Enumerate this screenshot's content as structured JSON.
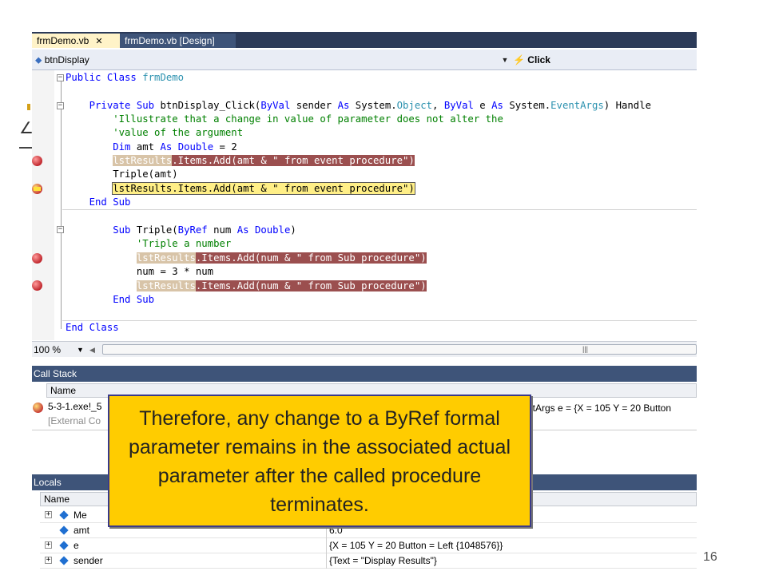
{
  "tabs": [
    {
      "label": "frmDemo.vb",
      "close": "✕"
    },
    {
      "label": "frmDemo.vb [Design]"
    }
  ],
  "nav": {
    "object_label": "btnDisplay",
    "event_label": "Click"
  },
  "code": {
    "lines": [
      [
        "Public Class ",
        "frmDemo"
      ],
      [
        ""
      ],
      [
        "    Private Sub ",
        "btnDisplay_Click(",
        "ByVal ",
        "sender ",
        "As ",
        "System.",
        "Object",
        ", ",
        "ByVal ",
        "e ",
        "As ",
        "System.",
        "EventArgs",
        ") Handle"
      ],
      [
        "        'Illustrate that a change in value of parameter does not alter the"
      ],
      [
        "        'value of the argument"
      ],
      [
        "        Dim ",
        "amt ",
        "As ",
        "Double",
        " = 2"
      ],
      [
        "        ",
        "lstResults",
        ".Items.Add(amt & \" from event procedure\")"
      ],
      [
        "        Triple(amt)"
      ],
      [
        "        ",
        "lstResults.Items.Add(amt & \" from event procedure\")"
      ],
      [
        "    End Sub"
      ],
      [
        ""
      ],
      [
        "        Sub ",
        "Triple(",
        "ByRef ",
        "num ",
        "As ",
        "Double",
        ")"
      ],
      [
        "            'Triple a number"
      ],
      [
        "            ",
        "lstResults",
        ".Items.Add(num & \" from Sub procedure\")"
      ],
      [
        "            num = 3 * num"
      ],
      [
        "            ",
        "lstResults",
        ".Items.Add(num & \" from Sub procedure\")"
      ],
      [
        "        End Sub"
      ],
      [
        ""
      ],
      [
        "End Class"
      ]
    ]
  },
  "zoom": {
    "value": "100 %"
  },
  "call_stack": {
    "title": "Call Stack",
    "column": "Name",
    "row1": "5-3-1.exe!_5",
    "row1_tail": "ntArgs e = {X = 105 Y = 20 Button",
    "row2": "[External Co"
  },
  "locals": {
    "title": "Locals",
    "column": "Name",
    "rows": [
      {
        "name": "Me",
        "value": "",
        "expandable": true
      },
      {
        "name": "amt",
        "value": "6.0",
        "expandable": false
      },
      {
        "name": "e",
        "value": "{X = 105 Y = 20 Button = Left {1048576}}",
        "expandable": true
      },
      {
        "name": "sender",
        "value": "{Text = \"Display Results\"}",
        "expandable": true
      }
    ]
  },
  "callout": {
    "text": "Therefore, any change to a ByRef formal parameter remains in the associated actual parameter after the called procedure terminates."
  },
  "page_number": "16",
  "colors": {
    "tab_strip": "#2b3a58",
    "panel_title": "#3e5479",
    "breakpoint": "#9b4f4f",
    "current_line": "#ffef87",
    "callout": "#ffcc00"
  }
}
